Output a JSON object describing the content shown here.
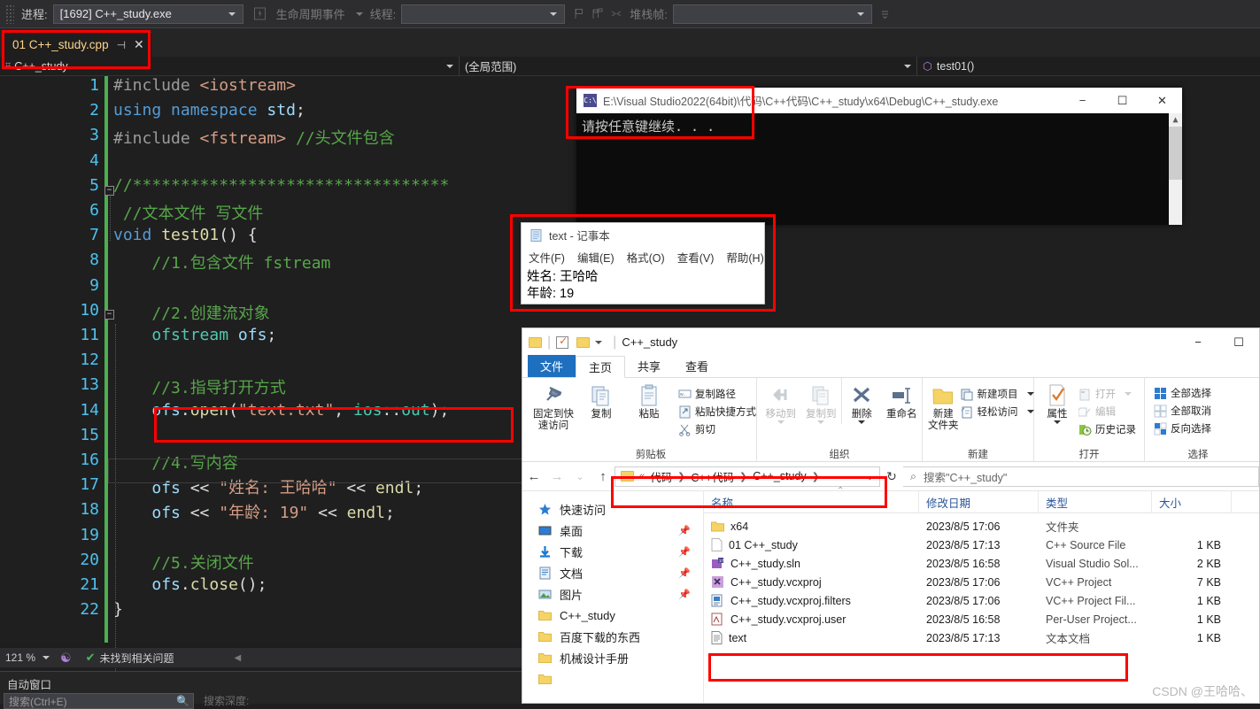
{
  "vs": {
    "debugbar": {
      "process_label": "进程:",
      "process_value": "[1692] C++_study.exe",
      "lifecycle_label": "生命周期事件",
      "thread_label": "线程:",
      "thread_value": "",
      "stackframe_label": "堆栈帧:",
      "stackframe_value": ""
    },
    "tab": {
      "title": "01 C++_study.cpp",
      "pin_icon": "pin-icon",
      "close_icon": "close-icon"
    },
    "navbar": {
      "project": "C++_study",
      "scope": "(全局范围)",
      "member": "test01()"
    },
    "status": {
      "zoom": "121 %",
      "issues": "未找到相关问题"
    },
    "bottom_pane": {
      "title": "自动窗口",
      "search_placeholder": "搜索(Ctrl+E)",
      "extra": "搜索深度:"
    },
    "code": [
      {
        "n": "1",
        "tokens": [
          [
            "k-pre",
            "#include "
          ],
          [
            "k-str",
            "<iostream>"
          ]
        ]
      },
      {
        "n": "2",
        "tokens": [
          [
            "k-kw",
            "using"
          ],
          [
            "k-pl",
            " "
          ],
          [
            "k-kw",
            "namespace"
          ],
          [
            "k-pl",
            " "
          ],
          [
            "k-var",
            "std"
          ],
          [
            "k-pl",
            ";"
          ]
        ]
      },
      {
        "n": "3",
        "tokens": [
          [
            "k-pre",
            "#include "
          ],
          [
            "k-str",
            "<fstream>"
          ],
          [
            "k-pl",
            " "
          ],
          [
            "k-cm",
            "//头文件包含"
          ]
        ]
      },
      {
        "n": "4",
        "tokens": []
      },
      {
        "n": "5",
        "tokens": [
          [
            "k-cm",
            "//*********************************"
          ]
        ]
      },
      {
        "n": "6",
        "tokens": [
          [
            "k-cm",
            " //文本文件 写文件"
          ]
        ]
      },
      {
        "n": "7",
        "tokens": [
          [
            "k-kw",
            "void"
          ],
          [
            "k-pl",
            " "
          ],
          [
            "k-fn",
            "test01"
          ],
          [
            "k-pl",
            "() {"
          ]
        ]
      },
      {
        "n": "8",
        "tokens": [
          [
            "k-cm",
            "    //1.包含文件 fstream"
          ]
        ]
      },
      {
        "n": "9",
        "tokens": []
      },
      {
        "n": "10",
        "tokens": [
          [
            "k-cm",
            "    //2.创建流对象"
          ]
        ]
      },
      {
        "n": "11",
        "tokens": [
          [
            "k-pl",
            "    "
          ],
          [
            "k-ty",
            "ofstream"
          ],
          [
            "k-pl",
            " "
          ],
          [
            "k-var",
            "ofs"
          ],
          [
            "k-pl",
            ";"
          ]
        ]
      },
      {
        "n": "12",
        "tokens": []
      },
      {
        "n": "13",
        "tokens": [
          [
            "k-cm",
            "    //3.指导打开方式"
          ]
        ]
      },
      {
        "n": "14",
        "tokens": [
          [
            "k-pl",
            "    "
          ],
          [
            "k-var",
            "ofs"
          ],
          [
            "k-pl",
            "."
          ],
          [
            "k-fn",
            "open"
          ],
          [
            "k-pl",
            "("
          ],
          [
            "k-str",
            "\"text.txt\""
          ],
          [
            "k-pl",
            ", "
          ],
          [
            "k-ty",
            "ios"
          ],
          [
            "k-pl",
            "::"
          ],
          [
            "k-ty",
            "out"
          ],
          [
            "k-pl",
            ");"
          ]
        ]
      },
      {
        "n": "15",
        "tokens": []
      },
      {
        "n": "16",
        "tokens": [
          [
            "k-cm",
            "    //4.写内容"
          ]
        ]
      },
      {
        "n": "17",
        "tokens": [
          [
            "k-pl",
            "    "
          ],
          [
            "k-var",
            "ofs"
          ],
          [
            "k-pl",
            " << "
          ],
          [
            "k-str",
            "\"姓名: 王哈哈\""
          ],
          [
            "k-pl",
            " << "
          ],
          [
            "k-fn",
            "endl"
          ],
          [
            "k-pl",
            ";"
          ]
        ]
      },
      {
        "n": "18",
        "tokens": [
          [
            "k-pl",
            "    "
          ],
          [
            "k-var",
            "ofs"
          ],
          [
            "k-pl",
            " << "
          ],
          [
            "k-str",
            "\"年龄: 19\""
          ],
          [
            "k-pl",
            " << "
          ],
          [
            "k-fn",
            "endl"
          ],
          [
            "k-pl",
            ";"
          ]
        ]
      },
      {
        "n": "19",
        "tokens": []
      },
      {
        "n": "20",
        "tokens": [
          [
            "k-cm",
            "    //5.关闭文件"
          ]
        ]
      },
      {
        "n": "21",
        "tokens": [
          [
            "k-pl",
            "    "
          ],
          [
            "k-var",
            "ofs"
          ],
          [
            "k-pl",
            "."
          ],
          [
            "k-fn",
            "close"
          ],
          [
            "k-pl",
            "();"
          ]
        ]
      },
      {
        "n": "22",
        "tokens": [
          [
            "k-pl",
            "}"
          ]
        ]
      }
    ]
  },
  "console": {
    "icon": "console-app-icon",
    "title": "E:\\Visual Studio2022(64bit)\\代码\\C++代码\\C++_study\\x64\\Debug\\C++_study.exe",
    "minimize": "−",
    "maximize": "☐",
    "close": "✕",
    "output": "请按任意键继续. . ."
  },
  "notepad": {
    "icon": "notepad-icon",
    "title": "text - 记事本",
    "menu": [
      "文件(F)",
      "编辑(E)",
      "格式(O)",
      "查看(V)",
      "帮助(H)"
    ],
    "lines": [
      "姓名: 王哈哈",
      "年龄: 19"
    ]
  },
  "explorer": {
    "title": "C++_study",
    "window_buttons": {
      "minimize": "−",
      "maximize": "☐"
    },
    "tabs": [
      {
        "label": "文件",
        "state": "file"
      },
      {
        "label": "主页",
        "state": "active"
      },
      {
        "label": "共享",
        "state": "normal"
      },
      {
        "label": "查看",
        "state": "normal"
      }
    ],
    "ribbon_groups": [
      {
        "name": "剪贴板",
        "big": [
          {
            "label": "固定到快\n速访问",
            "icon": "pin-icon",
            "dim": false
          },
          {
            "label": "复制",
            "icon": "copy-icon",
            "dim": false
          },
          {
            "label": "粘贴",
            "icon": "paste-icon",
            "dim": false
          }
        ],
        "small": [
          {
            "label": "复制路径",
            "icon": "copy-path-icon",
            "dim": false
          },
          {
            "label": "粘贴快捷方式",
            "icon": "paste-shortcut-icon",
            "dim": false
          },
          {
            "label": "剪切",
            "icon": "cut-icon",
            "dim": false
          }
        ]
      },
      {
        "name": "组织",
        "big": [
          {
            "label": "移动到",
            "icon": "move-to-icon",
            "dim": true
          },
          {
            "label": "复制到",
            "icon": "copy-to-icon",
            "dim": true
          },
          {
            "label": "删除",
            "icon": "delete-icon",
            "dim": false
          },
          {
            "label": "重命名",
            "icon": "rename-icon",
            "dim": false
          }
        ],
        "small": []
      },
      {
        "name": "新建",
        "big": [
          {
            "label": "新建\n文件夹",
            "icon": "new-folder-icon",
            "dim": false
          }
        ],
        "small": [
          {
            "label": "新建项目",
            "icon": "new-item-icon",
            "dim": false
          },
          {
            "label": "轻松访问",
            "icon": "easy-access-icon",
            "dim": false
          }
        ]
      },
      {
        "name": "打开",
        "big": [
          {
            "label": "属性",
            "icon": "properties-icon",
            "dim": false
          }
        ],
        "small": [
          {
            "label": "打开",
            "icon": "open-icon",
            "dim": true
          },
          {
            "label": "编辑",
            "icon": "edit-icon",
            "dim": true
          },
          {
            "label": "历史记录",
            "icon": "history-icon",
            "dim": false
          }
        ]
      },
      {
        "name": "选择",
        "big": [],
        "small": [
          {
            "label": "全部选择",
            "icon": "select-all-icon",
            "dim": false
          },
          {
            "label": "全部取消",
            "icon": "select-none-icon",
            "dim": false
          },
          {
            "label": "反向选择",
            "icon": "invert-selection-icon",
            "dim": false
          }
        ]
      }
    ],
    "nav": {
      "back": "←",
      "forward": "→",
      "recent": "⌄",
      "up": "↑",
      "refresh": "↻",
      "breadcrumbs": [
        "«",
        "代码",
        "C++代码",
        "C++_study"
      ],
      "search_placeholder": "搜索\"C++_study\"",
      "search_icon": "search-icon"
    },
    "sidebar": [
      {
        "label": "快速访问",
        "icon": "quick-access-icon",
        "pinned": false
      },
      {
        "label": "桌面",
        "icon": "desktop-icon",
        "pinned": true
      },
      {
        "label": "下载",
        "icon": "downloads-icon",
        "pinned": true
      },
      {
        "label": "文档",
        "icon": "documents-icon",
        "pinned": true
      },
      {
        "label": "图片",
        "icon": "pictures-icon",
        "pinned": true
      },
      {
        "label": "C++_study",
        "icon": "folder-icon",
        "pinned": false
      },
      {
        "label": "百度下载的东西",
        "icon": "folder-icon",
        "pinned": false
      },
      {
        "label": "机械设计手册",
        "icon": "folder-icon",
        "pinned": false
      },
      {
        "label": "",
        "icon": "folder-icon",
        "pinned": false
      }
    ],
    "columns": [
      "名称",
      "修改日期",
      "类型",
      "大小"
    ],
    "files": [
      {
        "name": "x64",
        "date": "2023/8/5 17:06",
        "type": "文件夹",
        "size": "",
        "icon": "folder-icon"
      },
      {
        "name": "01 C++_study",
        "date": "2023/8/5 17:13",
        "type": "C++ Source File",
        "size": "1 KB",
        "icon": "cpp-source-icon"
      },
      {
        "name": "C++_study.sln",
        "date": "2023/8/5 16:58",
        "type": "Visual Studio Sol...",
        "size": "2 KB",
        "icon": "sln-icon"
      },
      {
        "name": "C++_study.vcxproj",
        "date": "2023/8/5 17:06",
        "type": "VC++ Project",
        "size": "7 KB",
        "icon": "vcxproj-icon"
      },
      {
        "name": "C++_study.vcxproj.filters",
        "date": "2023/8/5 17:06",
        "type": "VC++ Project Fil...",
        "size": "1 KB",
        "icon": "filters-icon"
      },
      {
        "name": "C++_study.vcxproj.user",
        "date": "2023/8/5 16:58",
        "type": "Per-User Project...",
        "size": "1 KB",
        "icon": "user-icon"
      },
      {
        "name": "text",
        "date": "2023/8/5 17:13",
        "type": "文本文档",
        "size": "1 KB",
        "icon": "text-file-icon"
      }
    ]
  },
  "watermark": "CSDN @王哈哈、",
  "colors": {
    "accent_red": "#ff0000",
    "vs_bg": "#1e1e1e",
    "explorer_blue": "#1e6fbf"
  }
}
